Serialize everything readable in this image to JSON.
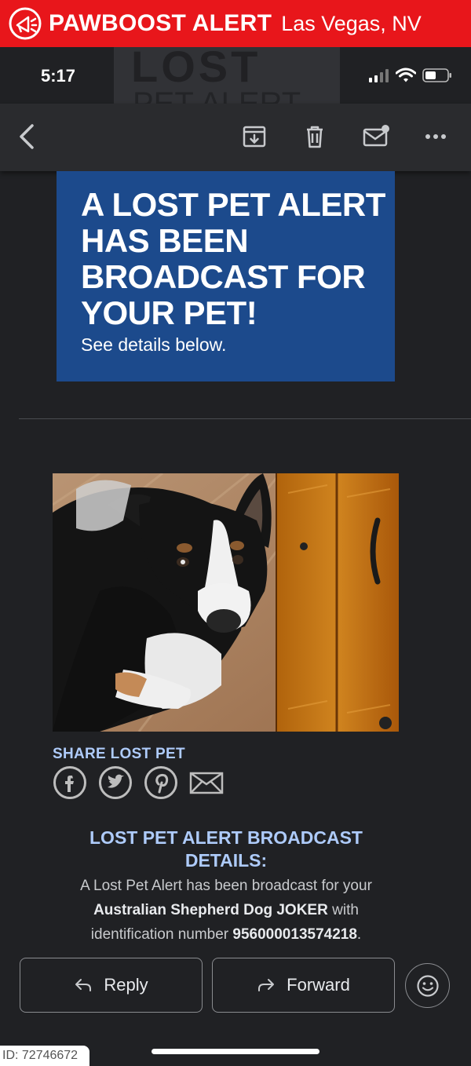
{
  "banner": {
    "brand": "PAWBOOST ALERT",
    "location": "Las Vegas, NV"
  },
  "status": {
    "time": "5:17"
  },
  "watermark": {
    "line1": "LOST",
    "line2": "PET ALERT"
  },
  "toolbar": {
    "icons": [
      "back-icon",
      "archive-icon",
      "trash-icon",
      "mark-unread-icon",
      "more-icon"
    ]
  },
  "hero": {
    "title": "A LOST PET ALERT HAS BEEN BROADCAST FOR YOUR PET!",
    "subtitle": "See details below."
  },
  "share": {
    "label": "SHARE LOST PET",
    "icons": [
      "facebook-icon",
      "twitter-icon",
      "pinterest-icon",
      "email-icon"
    ]
  },
  "details": {
    "title": "LOST PET ALERT BROADCAST DETAILS:",
    "text_before": "A Lost Pet Alert has been broadcast for your",
    "pet_name": "Australian Shepherd Dog JOKER",
    "text_with": "with",
    "text_id": "identification number",
    "id_number": "956000013574218",
    "period": "."
  },
  "actions": {
    "reply": "Reply",
    "forward": "Forward"
  },
  "footer": {
    "id_tag": "ID: 72746672"
  },
  "colors": {
    "banner": "#e8161b",
    "hero": "#1c4a8c",
    "link": "#aecbfa",
    "background": "#202124"
  }
}
